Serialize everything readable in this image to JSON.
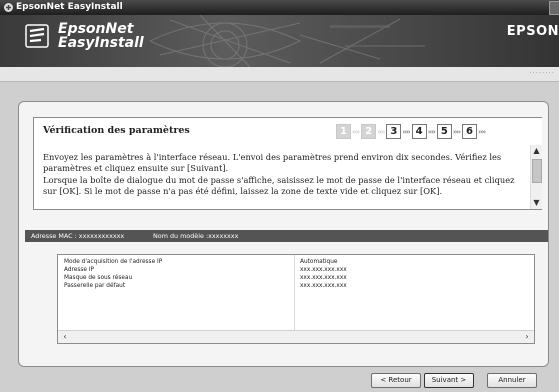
{
  "window": {
    "title": "EpsonNet EasyInstall"
  },
  "banner": {
    "brand_line1": "EpsonNet",
    "brand_line2": "EasyInstall",
    "vendor": "EPSON"
  },
  "subbar": {
    "dots": "········"
  },
  "header": {
    "title": "Vérification des paramètres",
    "steps": [
      {
        "label": "1",
        "state": "done"
      },
      {
        "label": "2",
        "state": "done"
      },
      {
        "label": "3",
        "state": "current"
      },
      {
        "label": "4",
        "state": "pending"
      },
      {
        "label": "5",
        "state": "pending"
      },
      {
        "label": "6",
        "state": "pending"
      }
    ],
    "arrow": "››››"
  },
  "description": {
    "para1": "Envoyez les paramètres à l'interface réseau. L'envoi des paramètres prend environ dix secondes. Vérifiez les paramètres et cliquez ensuite sur [Suivant].",
    "para2": "Lorsque la boîte de dialogue du mot de passe s'affiche, saisissez le mot de passe de l'interface réseau et cliquez sur [OK]. Si le mot de passe n'a pas été défini, laissez la zone de texte vide et cliquez sur [OK]."
  },
  "info": {
    "mac": "Adresse MAC : xxxxxxxxxxxx",
    "model": "Nom du modèle :xxxxxxxx"
  },
  "settings": {
    "rows": [
      {
        "label": "Mode d'acquisition de l'adresse IP",
        "value": "Automatique"
      },
      {
        "label": "Adresse IP",
        "value": "xxx.xxx.xxx.xxx"
      },
      {
        "label": "Masque de sous réseau",
        "value": "xxx.xxx.xxx.xxx"
      },
      {
        "label": "Passerelle par défaut",
        "value": "xxx.xxx.xxx.xxx"
      }
    ]
  },
  "buttons": {
    "back": "< Retour",
    "next": "Suivant >",
    "cancel": "Annuler"
  },
  "colors": {
    "infobar": "#545454",
    "titlebar": "#2a2a2a",
    "panel": "#f4f4f4"
  }
}
